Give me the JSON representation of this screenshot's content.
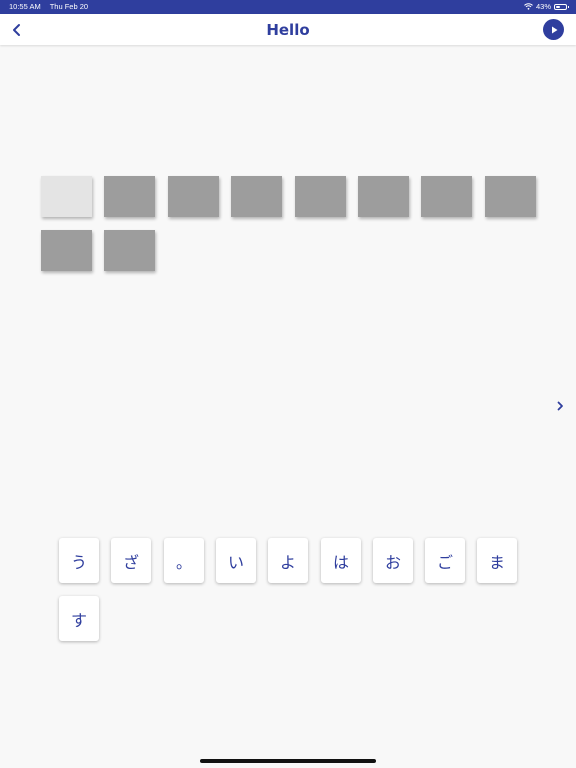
{
  "status_bar": {
    "time": "10:55 AM",
    "date": "Thu Feb 20",
    "battery_percent": "43%",
    "battery_level": 0.43,
    "icons": [
      "wifi-icon",
      "battery-icon"
    ]
  },
  "header": {
    "title": "Hello",
    "back_icon": "chevron-left-icon",
    "play_icon": "play-icon"
  },
  "answer": {
    "slot_count": 10,
    "active_slot_index": 0
  },
  "navigation": {
    "next_icon": "chevron-right-icon"
  },
  "tiles": [
    "う",
    "ざ",
    "。",
    "い",
    "よ",
    "は",
    "お",
    "ご",
    "ま",
    "す"
  ],
  "colors": {
    "accent": "#2f3e9e",
    "background": "#f8f8f8",
    "slot_filled": "#9d9d9d",
    "slot_active": "#e4e4e4",
    "tile_bg": "#ffffff"
  }
}
